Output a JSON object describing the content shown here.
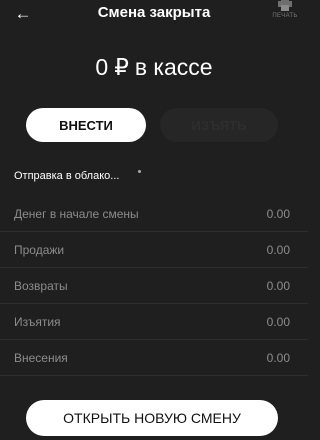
{
  "header": {
    "title": "Смена закрыта",
    "print_label": "ПЕЧАТЬ"
  },
  "cash": {
    "amount": "0",
    "currency": "₽",
    "suffix": "в кассе"
  },
  "actions": {
    "deposit_label": "ВНЕСТИ",
    "withdraw_label": "ИЗЪЯТЬ"
  },
  "sync_status": "Отправка в облако...",
  "summary": [
    {
      "label": "Денег в начале смены",
      "value": "0.00"
    },
    {
      "label": "Продажи",
      "value": "0.00"
    },
    {
      "label": "Возвраты",
      "value": "0.00"
    },
    {
      "label": "Изъятия",
      "value": "0.00"
    },
    {
      "label": "Внесения",
      "value": "0.00"
    }
  ],
  "open_shift_label": "ОТКРЫТЬ НОВУЮ СМЕНУ"
}
